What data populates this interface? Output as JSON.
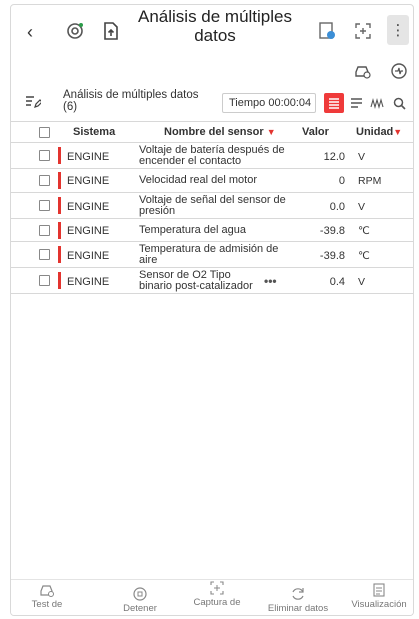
{
  "header": {
    "title": "Análisis de múltiples datos",
    "icons": [
      "back-icon",
      "dtc-scan-icon",
      "save-file-icon",
      "report-icon",
      "focus-icon",
      "more-icon"
    ]
  },
  "row2_icons": [
    "vehicle-check-icon",
    "battery-icon"
  ],
  "toolbar": {
    "title": "Análisis de múltiples datos (6)",
    "timer": "Tiempo 00:00:04",
    "views": [
      "grid-view",
      "list-view",
      "graph-view",
      "search"
    ]
  },
  "table": {
    "headers": {
      "system": "Sistema",
      "sensor": "Nombre del sensor",
      "value": "Valor",
      "unit": "Unidad"
    },
    "rows": [
      {
        "system": "ENGINE",
        "sensor": "Voltaje de batería después de encender el contacto",
        "value": "12.0",
        "unit": "V"
      },
      {
        "system": "ENGINE",
        "sensor": "Velocidad real del motor",
        "value": "0",
        "unit": "RPM"
      },
      {
        "system": "ENGINE",
        "sensor": "Voltaje de señal del sensor de presión",
        "value": "0.0",
        "unit": "V"
      },
      {
        "system": "ENGINE",
        "sensor": "Temperatura del agua",
        "value": "-39.8",
        "unit": "℃"
      },
      {
        "system": "ENGINE",
        "sensor": "Temperatura de admisión de aire",
        "value": "-39.8",
        "unit": "℃"
      },
      {
        "system": "ENGINE",
        "sensor": "Sensor de O2 Tipo binario post-catalizador",
        "value": "0.4",
        "unit": "V"
      }
    ]
  },
  "bottom_nav": [
    {
      "label": "Test de",
      "icon": "car-test-icon"
    },
    {
      "label": "Detener",
      "icon": "stop-icon"
    },
    {
      "label": "Captura de",
      "icon": "capture-icon"
    },
    {
      "label": "Eliminar datos",
      "icon": "refresh-icon"
    },
    {
      "label": "Visualización",
      "icon": "visualization-icon"
    }
  ],
  "colors": {
    "accent": "#e3342f"
  }
}
